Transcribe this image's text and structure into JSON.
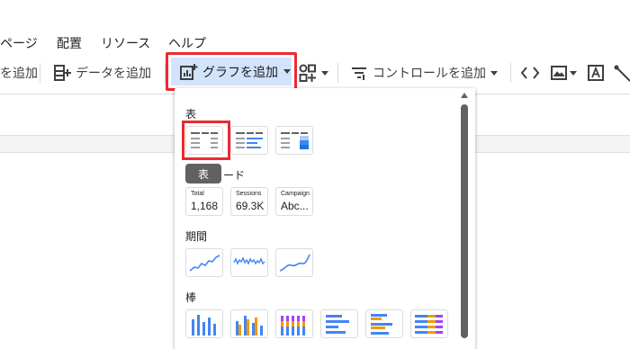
{
  "menu": [
    "ページ",
    "配置",
    "リソース",
    "ヘルプ"
  ],
  "toolbar": {
    "page_add": "を追加",
    "data_add": "データを追加",
    "chart_add": "グラフを追加",
    "control_add": "コントロールを追加"
  },
  "panel": {
    "section_table": "表",
    "section_scorecard_partial": "ード",
    "tooltip": "表",
    "section_period": "期間",
    "section_bar": "棒",
    "scorecards": [
      {
        "label": "Total",
        "value": "1,168"
      },
      {
        "label": "Sessions",
        "value": "69.3K"
      },
      {
        "label": "Campaign",
        "value": "Abc..."
      }
    ]
  },
  "colors": {
    "accent_blue": "#4285f4",
    "highlight_red": "#ea2a33",
    "selected_bg": "#d2e3fc",
    "orange": "#f29900",
    "purple": "#a142f4"
  }
}
